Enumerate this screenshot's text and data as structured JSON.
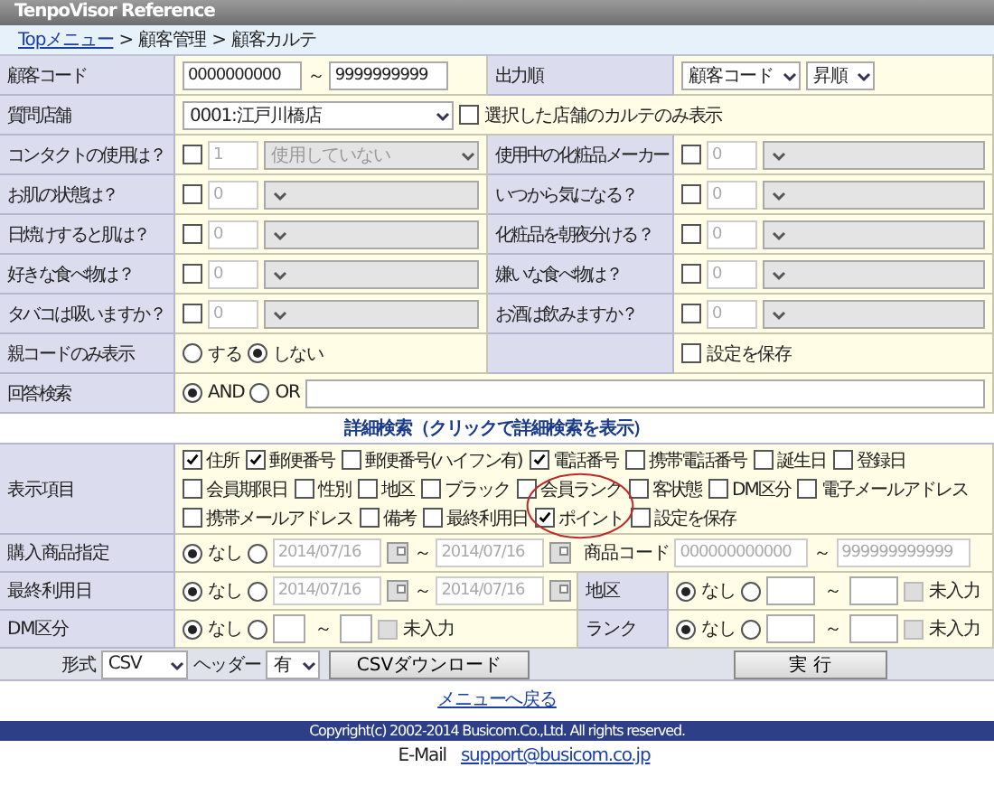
{
  "window": {
    "title": "TenpoVisor Reference"
  },
  "breadcrumb": {
    "link": "Topメニュー",
    "separator": ">",
    "items": [
      "顧客管理",
      "顧客カルテ"
    ]
  },
  "customer_code": {
    "label": "顧客コード",
    "from": "0000000000",
    "range_sep": "～",
    "to": "9999999999"
  },
  "output_order": {
    "label": "出力順",
    "field": "顧客コード",
    "direction": "昇順"
  },
  "store": {
    "label": "質問店舗",
    "value": "0001:江戸川橋店",
    "only_selected": {
      "label": "選択した店舗のカルテのみ表示",
      "checked": false
    }
  },
  "questions": [
    {
      "left": {
        "label": "コンタクトの使用は？",
        "checked": false,
        "count": "1",
        "answer": "使用していない"
      },
      "right": {
        "label": "使用中の化粧品メーカー",
        "checked": false,
        "count": "0"
      }
    },
    {
      "left": {
        "label": "お肌の状態は？",
        "checked": false,
        "count": "0"
      },
      "right": {
        "label": "いつから気になる？",
        "checked": false,
        "count": "0"
      }
    },
    {
      "left": {
        "label": "日焼けすると肌は？",
        "checked": false,
        "count": "0"
      },
      "right": {
        "label": "化粧品を朝夜分ける？",
        "checked": false,
        "count": "0"
      }
    },
    {
      "left": {
        "label": "好きな食べ物は？",
        "checked": false,
        "count": "0"
      },
      "right": {
        "label": "嫌いな食べ物は？",
        "checked": false,
        "count": "0"
      }
    },
    {
      "left": {
        "label": "タバコは吸いますか？",
        "checked": false,
        "count": "0"
      },
      "right": {
        "label": "お酒は飲みますか？",
        "checked": false,
        "count": "0"
      }
    }
  ],
  "parent_code": {
    "label": "親コードのみ表示",
    "options": [
      {
        "label": "する",
        "selected": false
      },
      {
        "label": "しない",
        "selected": true
      }
    ]
  },
  "save_settings": {
    "label": "設定を保存",
    "checked": false
  },
  "answer_search": {
    "label": "回答検索",
    "options": [
      {
        "label": "AND",
        "selected": true
      },
      {
        "label": "OR",
        "selected": false
      }
    ]
  },
  "detail_heading": "詳細検索（クリックで詳細検索を表示）",
  "display_items": {
    "label": "表示項目",
    "items": [
      {
        "label": "住所",
        "checked": true
      },
      {
        "label": "郵便番号",
        "checked": true
      },
      {
        "label": "郵便番号(ハイフン有)",
        "checked": false
      },
      {
        "label": "電話番号",
        "checked": true
      },
      {
        "label": "携帯電話番号",
        "checked": false
      },
      {
        "label": "誕生日",
        "checked": false
      },
      {
        "label": "登録日",
        "checked": false
      },
      {
        "label": "会員期限日",
        "checked": false
      },
      {
        "label": "性別",
        "checked": false
      },
      {
        "label": "地区",
        "checked": false
      },
      {
        "label": "ブラック",
        "checked": false
      },
      {
        "label": "会員ランク",
        "checked": false
      },
      {
        "label": "客状態",
        "checked": false
      },
      {
        "label": "DM区分",
        "checked": false
      },
      {
        "label": "電子メールアドレス",
        "checked": false
      },
      {
        "label": "携帯メールアドレス",
        "checked": false
      },
      {
        "label": "備考",
        "checked": false
      },
      {
        "label": "最終利用日",
        "checked": false
      },
      {
        "label": "ポイント",
        "checked": true
      },
      {
        "label": "設定を保存",
        "checked": false
      }
    ]
  },
  "purchase": {
    "label": "購入商品指定",
    "options": [
      {
        "label": "なし",
        "selected": true
      },
      {
        "selected": false
      }
    ],
    "date_from": "2014/07/16",
    "range_sep": "～",
    "date_to": "2014/07/16",
    "product_code": {
      "label": "商品コード",
      "from": "000000000000",
      "range_sep": "～",
      "to": "999999999999"
    }
  },
  "last_use": {
    "label": "最終利用日",
    "options": [
      {
        "label": "なし",
        "selected": true
      },
      {
        "selected": false
      }
    ],
    "date_from": "2014/07/16",
    "range_sep": "～",
    "date_to": "2014/07/16"
  },
  "area": {
    "label": "地区",
    "options": [
      {
        "label": "なし",
        "selected": true
      },
      {
        "selected": false
      }
    ],
    "range_sep": "～",
    "unentered": {
      "label": "未入力",
      "checked": false
    }
  },
  "dm": {
    "label": "DM区分",
    "options": [
      {
        "label": "なし",
        "selected": true
      },
      {
        "selected": false
      }
    ],
    "range_sep": "～",
    "unentered": {
      "label": "未入力",
      "checked": false
    }
  },
  "rank": {
    "label": "ランク",
    "options": [
      {
        "label": "なし",
        "selected": true
      },
      {
        "selected": false
      }
    ],
    "range_sep": "～",
    "unentered": {
      "label": "未入力",
      "checked": false
    }
  },
  "export": {
    "format_label": "形式",
    "format": "CSV",
    "header_label": "ヘッダー",
    "header": "有",
    "download": "CSVダウンロード",
    "run": "実 行"
  },
  "back_link": "メニューへ戻る",
  "copyright": "Copyright(c) 2002-2014 Busicom.Co.,Ltd. All rights reserved.",
  "contact": {
    "label": "E-Mail",
    "email": "support@busicom.co.jp"
  }
}
